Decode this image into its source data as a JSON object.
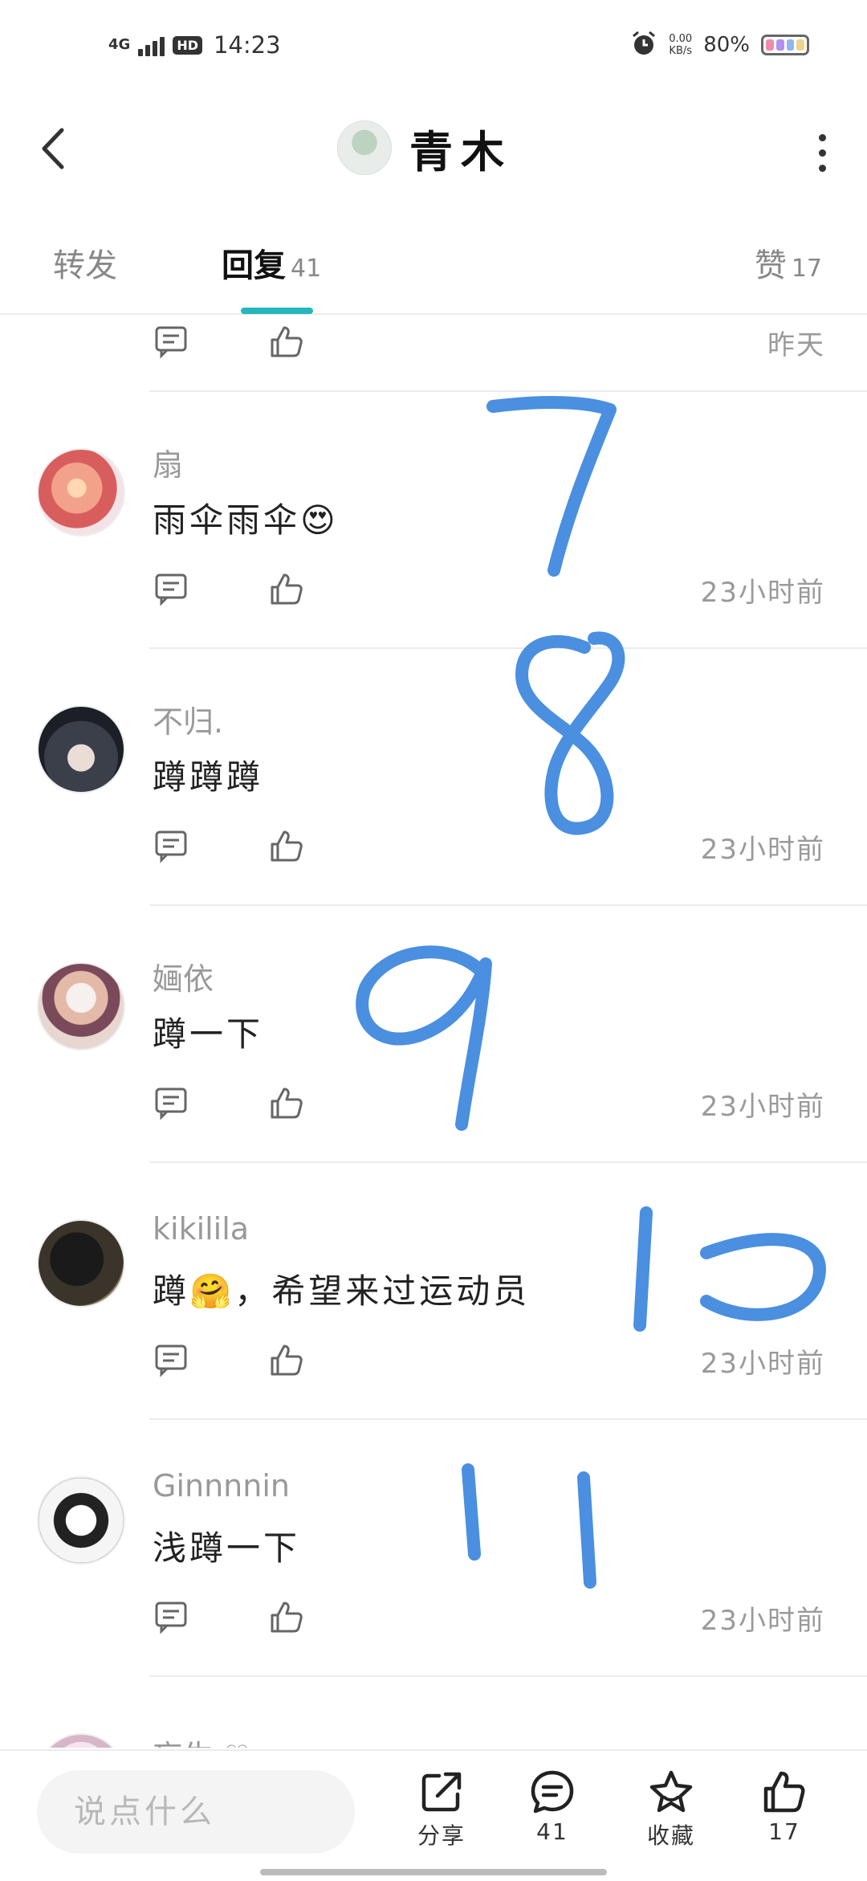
{
  "status_bar": {
    "network": "4G",
    "hd": "HD",
    "time": "14:23",
    "speed_value": "0.00",
    "speed_unit": "KB/s",
    "battery": "80%"
  },
  "header": {
    "title": "青木",
    "back_icon": "chevron-left-icon",
    "more_icon": "more-vertical-icon"
  },
  "tabs": {
    "forward": "转发",
    "reply": "回复",
    "reply_count": "41",
    "like": "赞",
    "like_count": "17"
  },
  "partial_top": {
    "time": "昨天"
  },
  "comments": [
    {
      "username": "扇",
      "text": "雨伞雨伞😍",
      "time": "23小时前"
    },
    {
      "username": "不归.",
      "text": "蹲蹲蹲",
      "time": "23小时前"
    },
    {
      "username": "婳依",
      "text": "蹲一下",
      "time": "23小时前"
    },
    {
      "username": "kikilila",
      "text": "蹲🤗，希望来过运动员",
      "time": "23小时前"
    },
    {
      "username": "Ginnnnin",
      "text": "浅蹲一下",
      "time": "23小时前"
    }
  ],
  "partial_bottom": {
    "username": "忘生 ♡"
  },
  "annotations": [
    "7",
    "8",
    "9",
    "10",
    "11"
  ],
  "bottom_bar": {
    "input_placeholder": "说点什么",
    "share": "分享",
    "comment_count": "41",
    "favorite": "收藏",
    "like_count": "17"
  },
  "colors": {
    "accent": "#25b7bd",
    "annotation": "#4a8fe0"
  }
}
